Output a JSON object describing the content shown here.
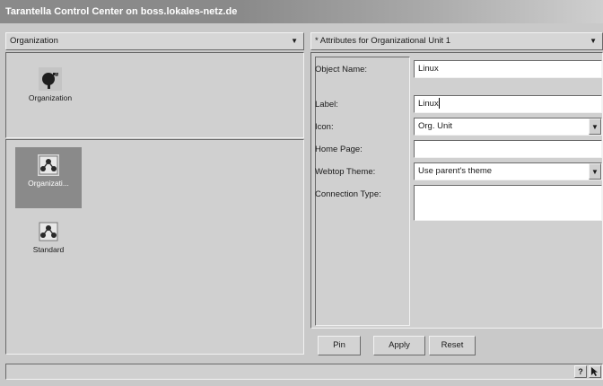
{
  "window": {
    "title": "Tarantella Control Center on boss.lokales-netz.de"
  },
  "left_pane": {
    "selector_label": "Organization",
    "top_items": [
      {
        "label": "Organization",
        "icon": "organization-icon"
      }
    ],
    "bottom_items": [
      {
        "label": "Organizati...",
        "icon": "org-unit-icon",
        "selected": true
      },
      {
        "label": "Standard",
        "icon": "org-unit-icon",
        "selected": false
      }
    ]
  },
  "right_pane": {
    "header": "* Attributes for Organizational Unit 1",
    "fields": {
      "object_name": {
        "label": "Object Name:",
        "value": "Linux"
      },
      "label": {
        "label": "Label:",
        "value": "Linux"
      },
      "icon": {
        "label": "Icon:",
        "value": "Org. Unit"
      },
      "home_page": {
        "label": "Home Page:",
        "value": ""
      },
      "webtop_theme": {
        "label": "Webtop Theme:",
        "value": "Use parent's theme"
      },
      "connection_type": {
        "label": "Connection Type:",
        "value": ""
      }
    },
    "buttons": {
      "pin": "Pin",
      "apply": "Apply",
      "reset": "Reset"
    }
  },
  "statusbar": {
    "help_label": "?"
  }
}
